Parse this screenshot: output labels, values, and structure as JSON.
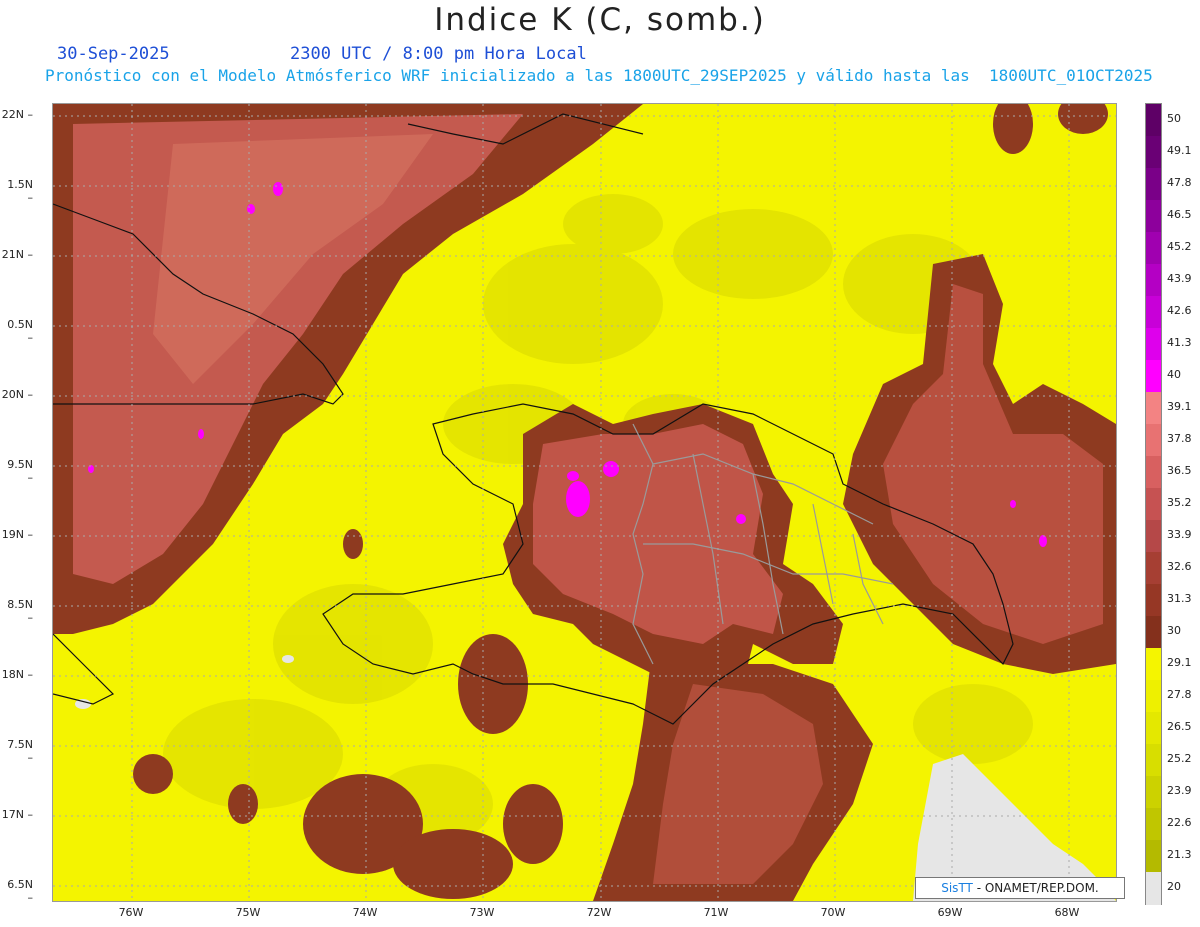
{
  "title": "Indice K (C, somb.)",
  "date": "30-Sep-2025",
  "time": "2300 UTC / 8:00 pm Hora Local",
  "forecast": "Pronóstico con el Modelo Atmósferico WRF inicializado a las 1800UTC_29SEP2025 y válido hasta las  1800UTC_01OCT2025",
  "credit": {
    "logo": "SisTT",
    "text": " - ONAMET/REP.DOM."
  },
  "lat_labels": [
    "22N",
    "1.5N",
    "21N",
    "0.5N",
    "20N",
    "9.5N",
    "19N",
    "8.5N",
    "18N",
    "7.5N",
    "17N",
    "6.5N"
  ],
  "lon_labels": [
    "76W",
    "75W",
    "74W",
    "73W",
    "72W",
    "71W",
    "70W",
    "69W",
    "68W"
  ],
  "colorbar": {
    "labels": [
      "50",
      "49.1",
      "47.8",
      "46.5",
      "45.2",
      "43.9",
      "42.6",
      "41.3",
      "40",
      "39.1",
      "37.8",
      "36.5",
      "35.2",
      "33.9",
      "32.6",
      "31.3",
      "30",
      "29.1",
      "27.8",
      "26.5",
      "25.2",
      "23.9",
      "22.6",
      "21.3",
      "20"
    ],
    "colors": [
      "#5e0066",
      "#6a0075",
      "#7a0088",
      "#8d009c",
      "#a000b0",
      "#b400c4",
      "#c800d8",
      "#de00ec",
      "#ff00ff",
      "#f38383",
      "#e87272",
      "#d86060",
      "#c65252",
      "#b54848",
      "#a63f33",
      "#963725",
      "#84301c",
      "#f5f500",
      "#eef000",
      "#e4e800",
      "#d8de00",
      "#ccd200",
      "#c0c600",
      "#b4ba00",
      "#e6e6e6"
    ]
  }
}
